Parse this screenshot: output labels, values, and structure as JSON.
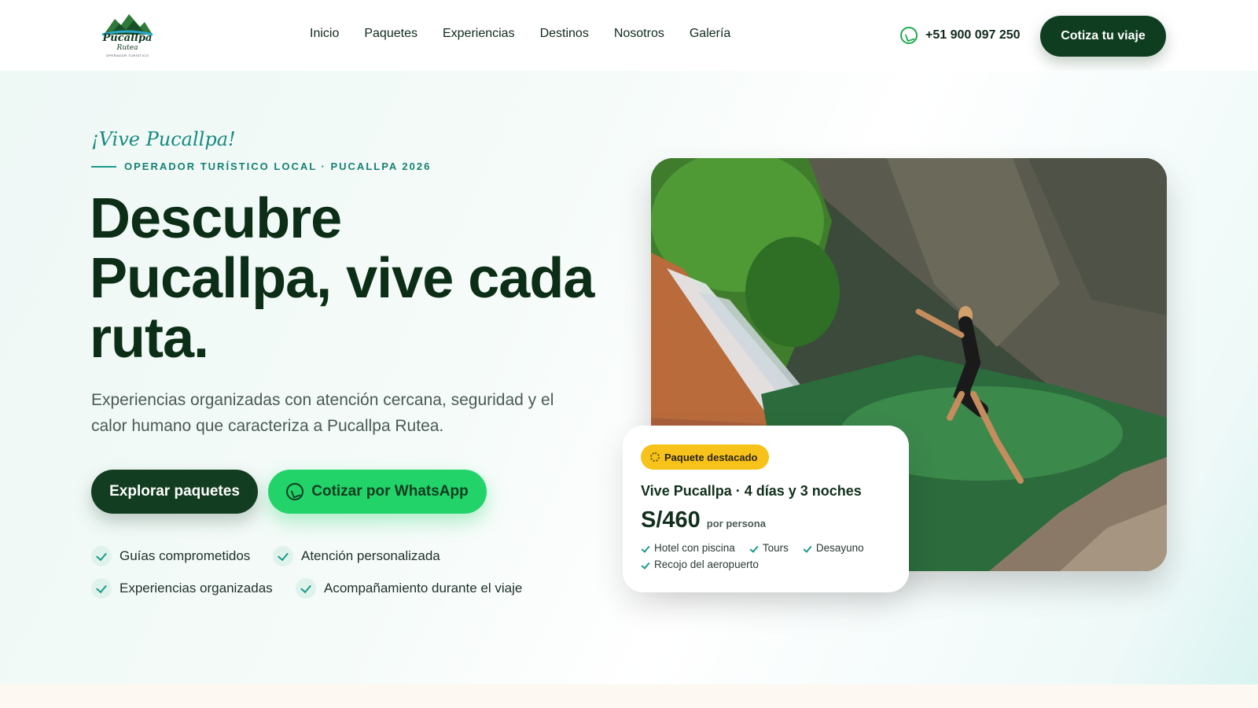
{
  "brand": {
    "logo_name": "Pucallpa",
    "logo_sub": "Rutea",
    "logo_tag": "OPERADOR TURÍSTICO"
  },
  "nav": {
    "items": [
      "Inicio",
      "Paquetes",
      "Experiencias",
      "Destinos",
      "Nosotros",
      "Galería"
    ]
  },
  "header": {
    "phone": "+51 900 097 250",
    "cta_label": "Cotiza tu viaje"
  },
  "hero": {
    "script_tagline": "¡Vive Pucallpa!",
    "kicker": "OPERADOR TURÍSTICO LOCAL · PUCALLPA 2026",
    "headline": [
      "Descubre",
      "Pucallpa, vive cada",
      "ruta."
    ],
    "lede": "Experiencias organizadas con atención cercana, seguridad y el calor humano que caracteriza a Pucallpa Rutea.",
    "primary_button": "Explorar paquetes",
    "whatsapp_button": "Cotizar por WhatsApp",
    "features": [
      "Guías comprometidos",
      "Atención personalizada",
      "Experiencias organizadas",
      "Acompañamiento durante el viaje"
    ]
  },
  "featured": {
    "badge": "Paquete destacado",
    "title": "Vive Pucallpa · 4 días y 3 noches",
    "price": "S/460",
    "price_note": "por persona",
    "includes": [
      "Hotel con piscina",
      "Tours",
      "Desayuno",
      "Recojo del aeropuerto"
    ]
  },
  "colors": {
    "brand_green": "#0f3d1f",
    "whatsapp_green": "#22d36a",
    "accent_teal": "#17897f",
    "badge_yellow": "#f7c21a"
  },
  "icons": {
    "whatsapp": "whatsapp-icon",
    "check": "check-icon",
    "sparkle": "sparkle-icon"
  }
}
